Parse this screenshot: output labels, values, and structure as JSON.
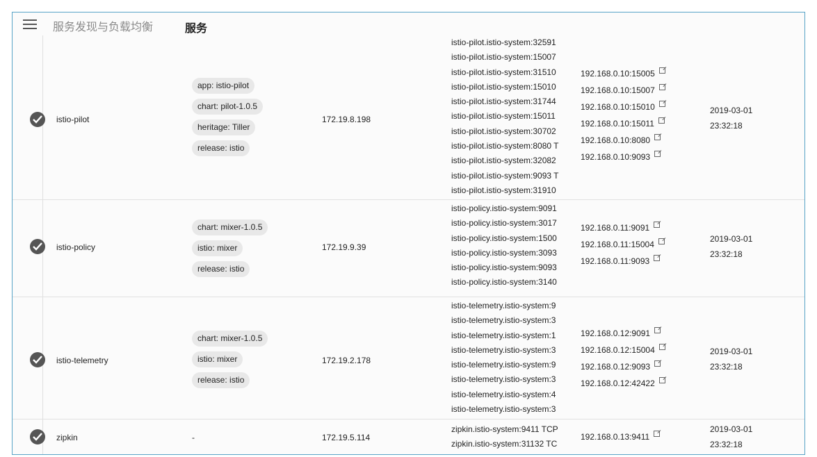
{
  "header": {
    "breadcrumb_parent": "服务发现与负载均衡",
    "page_title": "服务"
  },
  "services": [
    {
      "name": "istio-pilot",
      "labels": [
        "app: istio-pilot",
        "chart: pilot-1.0.5",
        "heritage: Tiller",
        "release: istio"
      ],
      "cluster_ip": "172.19.8.198",
      "internal_endpoints": [
        "istio-pilot.istio-system:32591",
        "istio-pilot.istio-system:15007",
        "istio-pilot.istio-system:31510",
        "istio-pilot.istio-system:15010",
        "istio-pilot.istio-system:31744",
        "istio-pilot.istio-system:15011",
        "istio-pilot.istio-system:30702",
        "istio-pilot.istio-system:8080 T",
        "istio-pilot.istio-system:32082",
        "istio-pilot.istio-system:9093 T",
        "istio-pilot.istio-system:31910"
      ],
      "external_endpoints": [
        "192.168.0.10:15005",
        "192.168.0.10:15007",
        "192.168.0.10:15010",
        "192.168.0.10:15011",
        "192.168.0.10:8080",
        "192.168.0.10:9093"
      ],
      "created_date": "2019-03-01",
      "created_time": "23:32:18"
    },
    {
      "name": "istio-policy",
      "labels": [
        "chart: mixer-1.0.5",
        "istio: mixer",
        "release: istio"
      ],
      "cluster_ip": "172.19.9.39",
      "internal_endpoints": [
        "istio-policy.istio-system:9091",
        "istio-policy.istio-system:3017",
        "istio-policy.istio-system:1500",
        "istio-policy.istio-system:3093",
        "istio-policy.istio-system:9093",
        "istio-policy.istio-system:3140"
      ],
      "external_endpoints": [
        "192.168.0.11:9091",
        "192.168.0.11:15004",
        "192.168.0.11:9093"
      ],
      "created_date": "2019-03-01",
      "created_time": "23:32:18"
    },
    {
      "name": "istio-telemetry",
      "labels": [
        "chart: mixer-1.0.5",
        "istio: mixer",
        "release: istio"
      ],
      "cluster_ip": "172.19.2.178",
      "internal_endpoints": [
        "istio-telemetry.istio-system:9",
        "istio-telemetry.istio-system:3",
        "istio-telemetry.istio-system:1",
        "istio-telemetry.istio-system:3",
        "istio-telemetry.istio-system:9",
        "istio-telemetry.istio-system:3",
        "istio-telemetry.istio-system:4",
        "istio-telemetry.istio-system:3"
      ],
      "external_endpoints": [
        "192.168.0.12:9091",
        "192.168.0.12:15004",
        "192.168.0.12:9093",
        "192.168.0.12:42422"
      ],
      "created_date": "2019-03-01",
      "created_time": "23:32:18"
    },
    {
      "name": "zipkin",
      "labels_empty": "-",
      "cluster_ip": "172.19.5.114",
      "internal_endpoints": [
        "zipkin.istio-system:9411 TCP",
        "zipkin.istio-system:31132 TC"
      ],
      "external_endpoints": [
        "192.168.0.13:9411"
      ],
      "created_date": "2019-03-01",
      "created_time": "23:32:18"
    }
  ]
}
